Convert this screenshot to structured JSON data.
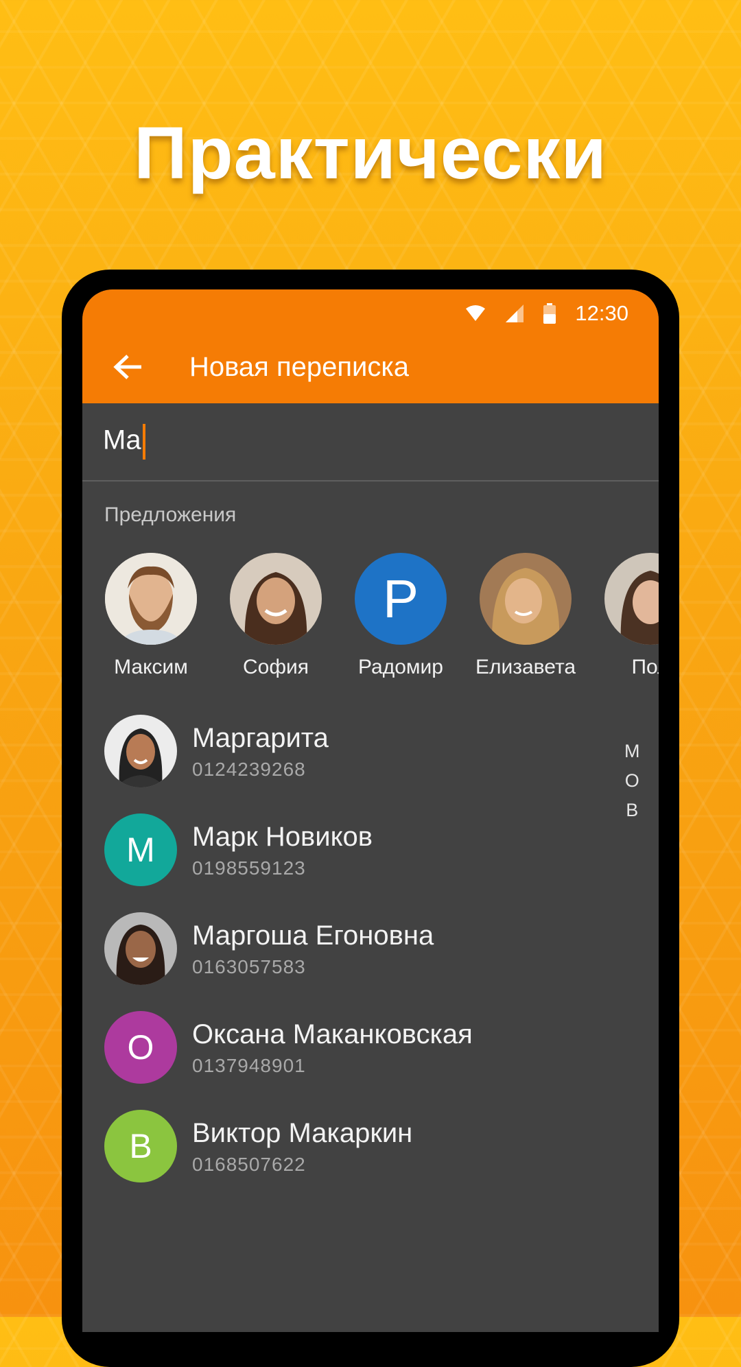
{
  "headline": "Практически",
  "status": {
    "time": "12:30",
    "icons": [
      "wifi-icon",
      "signal-icon",
      "battery-icon"
    ]
  },
  "toolbar": {
    "title": "Новая переписка",
    "back_icon": "arrow-left-icon"
  },
  "search": {
    "value": "Ma"
  },
  "suggestions": {
    "label": "Предложения",
    "items": [
      {
        "name": "Максим",
        "avatar": "photo"
      },
      {
        "name": "София",
        "avatar": "photo"
      },
      {
        "name": "Радомир",
        "avatar": "letter",
        "letter": "P",
        "color": "#1e73c6"
      },
      {
        "name": "Елизавета",
        "avatar": "photo"
      },
      {
        "name": "Пол",
        "avatar": "photo"
      }
    ]
  },
  "contacts": [
    {
      "name": "Маргарита",
      "phone": "0124239268",
      "avatar": "photo"
    },
    {
      "name": "Марк Новиков",
      "phone": "0198559123",
      "avatar": "letter",
      "letter": "M",
      "color": "#12a89a"
    },
    {
      "name": "Маргоша Егоновна",
      "phone": "0163057583",
      "avatar": "photo"
    },
    {
      "name": "Оксана Маканковская",
      "phone": "0137948901",
      "avatar": "letter",
      "letter": "O",
      "color": "#ad3a9e"
    },
    {
      "name": "Виктор Макаркин",
      "phone": "0168507622",
      "avatar": "letter",
      "letter": "B",
      "color": "#8bc53f"
    }
  ],
  "index_letters": [
    "M",
    "O",
    "B"
  ],
  "colors": {
    "accent": "#f57c05",
    "background": "#424242"
  }
}
